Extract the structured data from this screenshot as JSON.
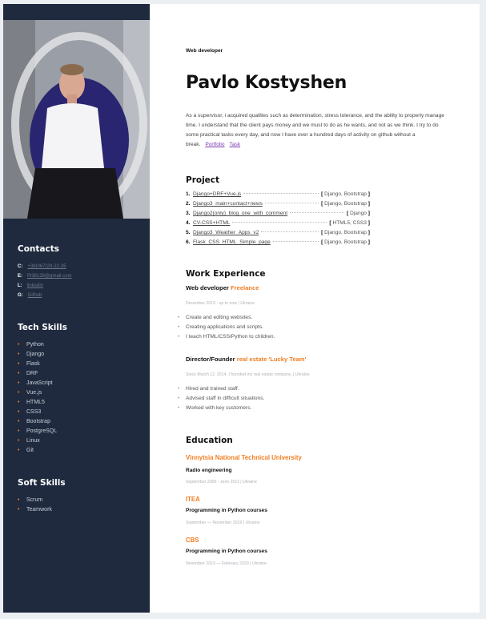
{
  "sidebar": {
    "contacts_title": "Contacts",
    "contacts": [
      {
        "key": "C:",
        "value": "+38(067)29-22-35"
      },
      {
        "key": "E:",
        "value": "Pl38138@gmail.com"
      },
      {
        "key": "L:",
        "value": "linkedin"
      },
      {
        "key": "G:",
        "value": "Github"
      }
    ],
    "tech_title": "Tech Skills",
    "tech_skills": [
      "Python",
      "Django",
      "Flask",
      "DRF",
      "JavaScript",
      "Vue.js",
      "HTML5",
      "CSS3",
      "Bootstrap",
      "PostgreSQL",
      "Linux",
      "Git"
    ],
    "soft_title": "Soft Skills",
    "soft_skills": [
      "Scrum",
      "Teamwork"
    ]
  },
  "header": {
    "role": "Web developer",
    "name": "Pavlo Kostyshen",
    "about": "As a supervisor, i acquired qualities such as determination, stress tolerance, and the ability to properly manage time. I understand that the client pays money and we must to do as he wants, and not as we think. I try to do some practical tasks every day, and now I have over a hundred days of activity on github without a break.",
    "portfolio_link": "Portfolio",
    "task_link": "Task"
  },
  "project": {
    "title": "Project",
    "items": [
      {
        "num": "1.",
        "name": "Django+DRF+Vue.js",
        "tech": "Django, Bootstrap"
      },
      {
        "num": "2.",
        "name": "Django3_main+contact+news",
        "tech": "Django, Bootstrap"
      },
      {
        "num": "3.",
        "name": "Django2(only)_blog_one_with_comment",
        "tech": "Django"
      },
      {
        "num": "4.",
        "name": "CV-CSS+HTML",
        "tech": "HTML5, CSS3"
      },
      {
        "num": "5.",
        "name": "Django3_Weather_Apps_v2",
        "tech": "Django, Bootstrap"
      },
      {
        "num": "6.",
        "name": "Flask_CSS_HTML_Simple_page",
        "tech": "Django, Bootstrap"
      }
    ]
  },
  "work": {
    "title": "Work Experience",
    "jobs": [
      {
        "role": "Web developer",
        "company": "Freelance",
        "meta": "December 2019 - up to now | Ukraine",
        "bullets": [
          "Create and editing websites.",
          "Creating applications and scripts.",
          "I teach HTML/CSS/Python to children."
        ]
      },
      {
        "role": "Director/Founder",
        "company": "real estate 'Lucky Team'",
        "meta": "Since March 12, 2014, I founded my real estate company. | Ukraine",
        "bullets": [
          "Hired and trained staff.",
          "Advised staff in difficult situations.",
          "Worked with key customers."
        ]
      }
    ]
  },
  "education": {
    "title": "Education",
    "items": [
      {
        "school": "Vinnytsia National Technical University",
        "degree": "Radio engineering",
        "meta": "September 2006 - June 2011 | Ukraine"
      },
      {
        "school": "ITEA",
        "degree": "Programming in Python courses",
        "meta": "September — November 2019 | Ukraine"
      },
      {
        "school": "CBS",
        "degree": "Programming in Python courses",
        "meta": "November 2019 — February 2020 | Ukraine"
      }
    ]
  },
  "colors": {
    "sidebar": "#1f2a3f",
    "accent": "#f07e22",
    "link": "#7a38b0"
  }
}
